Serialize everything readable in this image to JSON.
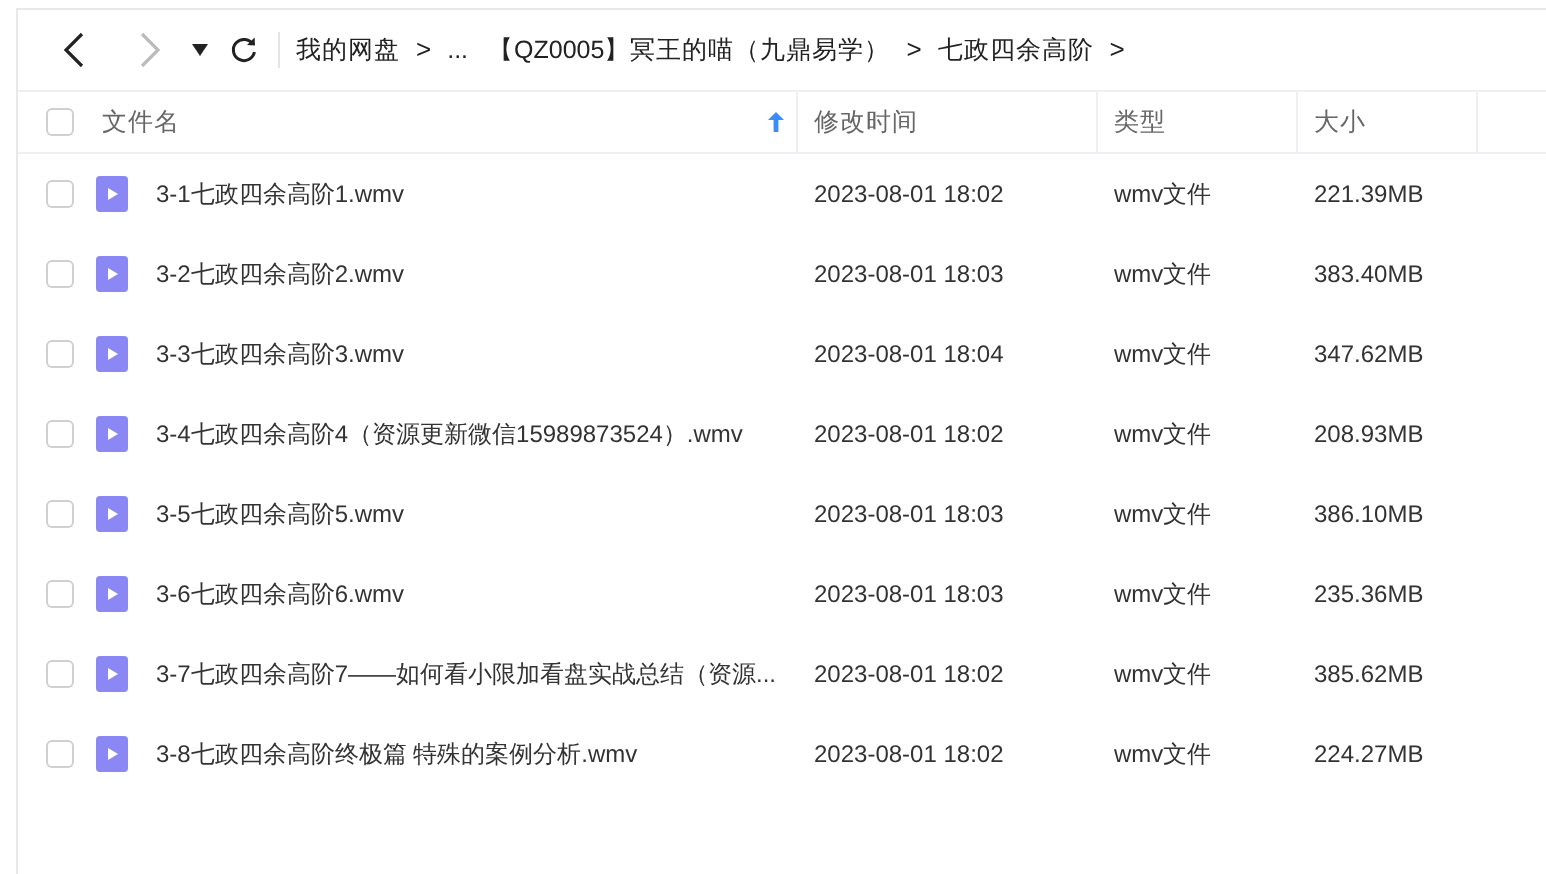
{
  "toolbar": {
    "back_disabled": false,
    "forward_disabled": true
  },
  "breadcrumb": [
    {
      "label": "我的网盘",
      "separator": ">"
    },
    {
      "label": "..."
    },
    {
      "label": "【QZ0005】冥王的喵（九鼎易学）",
      "separator": ">"
    },
    {
      "label": "七政四余高阶",
      "separator": ">"
    }
  ],
  "table": {
    "all_checked": false,
    "columns": [
      {
        "label": "文件名",
        "sorted": true
      },
      {
        "label": "修改时间",
        "sorted": false
      },
      {
        "label": "类型",
        "sorted": false
      },
      {
        "label": "大小",
        "sorted": false
      }
    ],
    "rows": [
      {
        "name": "3-1七政四余高阶1.wmv",
        "modified": "2023-08-01 18:02",
        "type": "wmv文件",
        "size": "221.39MB",
        "checked": false
      },
      {
        "name": "3-2七政四余高阶2.wmv",
        "modified": "2023-08-01 18:03",
        "type": "wmv文件",
        "size": "383.40MB",
        "checked": false
      },
      {
        "name": "3-3七政四余高阶3.wmv",
        "modified": "2023-08-01 18:04",
        "type": "wmv文件",
        "size": "347.62MB",
        "checked": false
      },
      {
        "name": "3-4七政四余高阶4（资源更新微信15989873524）.wmv",
        "modified": "2023-08-01 18:02",
        "type": "wmv文件",
        "size": "208.93MB",
        "checked": false
      },
      {
        "name": "3-5七政四余高阶5.wmv",
        "modified": "2023-08-01 18:03",
        "type": "wmv文件",
        "size": "386.10MB",
        "checked": false
      },
      {
        "name": "3-6七政四余高阶6.wmv",
        "modified": "2023-08-01 18:03",
        "type": "wmv文件",
        "size": "235.36MB",
        "checked": false
      },
      {
        "name": "3-7七政四余高阶7——如何看小限加看盘实战总结（资源...",
        "modified": "2023-08-01 18:02",
        "type": "wmv文件",
        "size": "385.62MB",
        "checked": false
      },
      {
        "name": "3-8七政四余高阶终极篇 特殊的案例分析.wmv",
        "modified": "2023-08-01 18:02",
        "type": "wmv文件",
        "size": "224.27MB",
        "checked": false
      }
    ]
  }
}
